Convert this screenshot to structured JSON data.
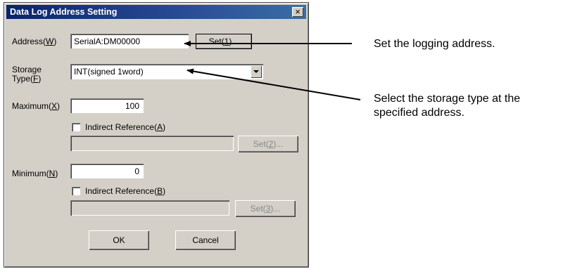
{
  "dialog": {
    "title": "Data Log Address Setting",
    "close_glyph": "×",
    "address": {
      "label": "Address",
      "key": "W",
      "value": "SerialA:DM00000",
      "button_label": "Set",
      "button_key": "1"
    },
    "storage_type": {
      "label_line1": "Storage",
      "label_line2": "Type",
      "key": "F",
      "value": "INT(signed 1word)"
    },
    "maximum": {
      "label": "Maximum",
      "key": "X",
      "value": "100",
      "indirect_label": "Indirect Reference",
      "indirect_key": "A",
      "indirect_checked": false,
      "button_label": "Set",
      "button_key": "2"
    },
    "minimum": {
      "label": "Minimum",
      "key": "N",
      "value": "0",
      "indirect_label": "Indirect Reference",
      "indirect_key": "B",
      "indirect_checked": false,
      "button_label": "Set",
      "button_key": "3"
    },
    "ok_label": "OK",
    "cancel_label": "Cancel"
  },
  "annotations": {
    "address_note": "Set the logging address.",
    "storage_note_line1": "Select the storage type at the",
    "storage_note_line2": "specified address."
  },
  "colors": {
    "title_gradient_start": "#0a246a",
    "title_gradient_end": "#3a6ea5",
    "dialog_face": "#d4d0c8"
  }
}
